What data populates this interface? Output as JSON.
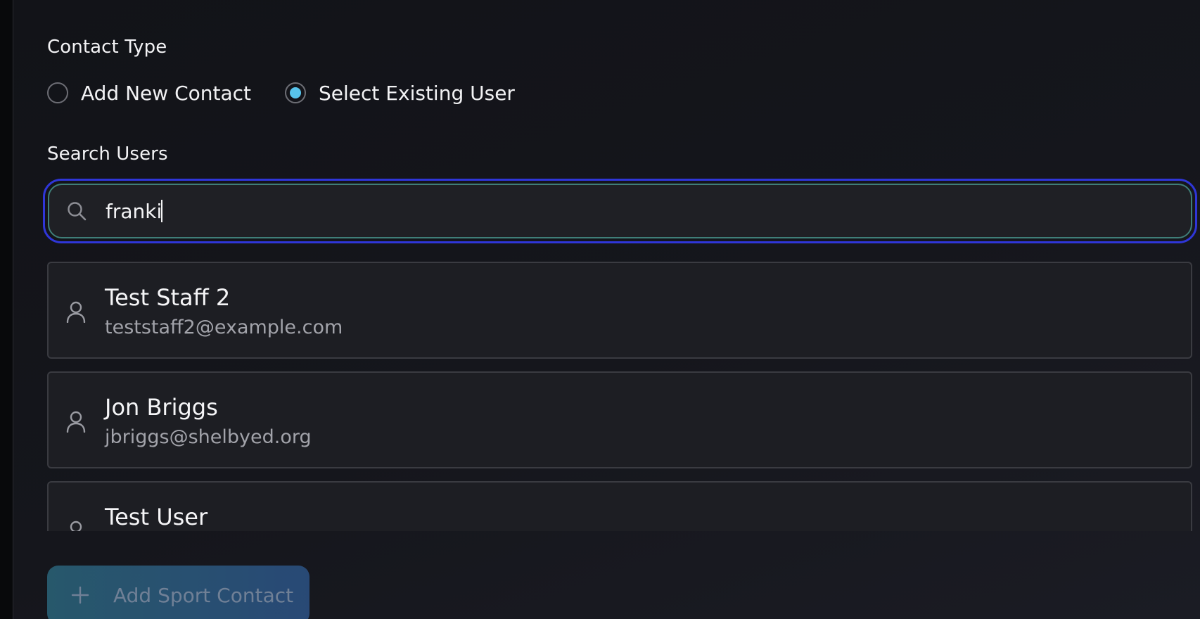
{
  "contact_type": {
    "label": "Contact Type",
    "options": [
      {
        "label": "Add New Contact",
        "selected": false
      },
      {
        "label": "Select Existing User",
        "selected": true
      }
    ]
  },
  "search": {
    "label": "Search Users",
    "value": "franki",
    "icon": "search-icon"
  },
  "results": [
    {
      "name": "Test Staff 2",
      "email": "teststaff2@example.com",
      "icon": "user-icon"
    },
    {
      "name": "Jon Briggs",
      "email": "jbriggs@shelbyed.org",
      "icon": "user-icon"
    },
    {
      "name": "Test User",
      "email": "",
      "icon": "user-icon"
    }
  ],
  "add_button": {
    "label": "Add Sport Contact",
    "icon": "plus-icon"
  },
  "colors": {
    "background": "#121318",
    "radio_selected": "#58c4ec",
    "focus_ring": "#2f36d8",
    "input_border": "#3f7e78",
    "button_gradient_start": "#2d6e86",
    "button_gradient_end": "#2f5a93"
  }
}
